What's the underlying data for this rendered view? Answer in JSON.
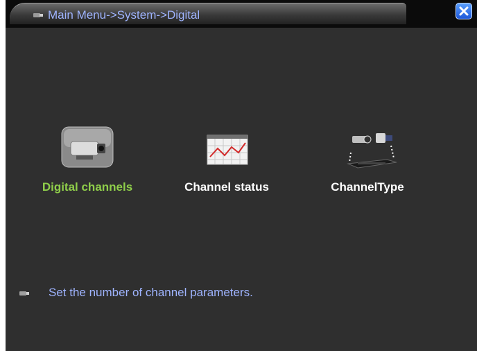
{
  "window": {
    "breadcrumb": "Main Menu->System->Digital",
    "close_icon": "close-icon"
  },
  "menu": {
    "items": [
      {
        "label": "Digital channels",
        "icon": "camera-icon",
        "active": true
      },
      {
        "label": "Channel status",
        "icon": "line-chart-icon",
        "active": false
      },
      {
        "label": "ChannelType",
        "icon": "camera-dvr-icon",
        "active": false
      }
    ]
  },
  "status": {
    "text": "Set the number of channel parameters.",
    "icon": "hint-icon"
  },
  "colors": {
    "background": "#2f2f2f",
    "title_text": "#9fb4ff",
    "active_label": "#8fce4a",
    "label": "#ffffff"
  }
}
